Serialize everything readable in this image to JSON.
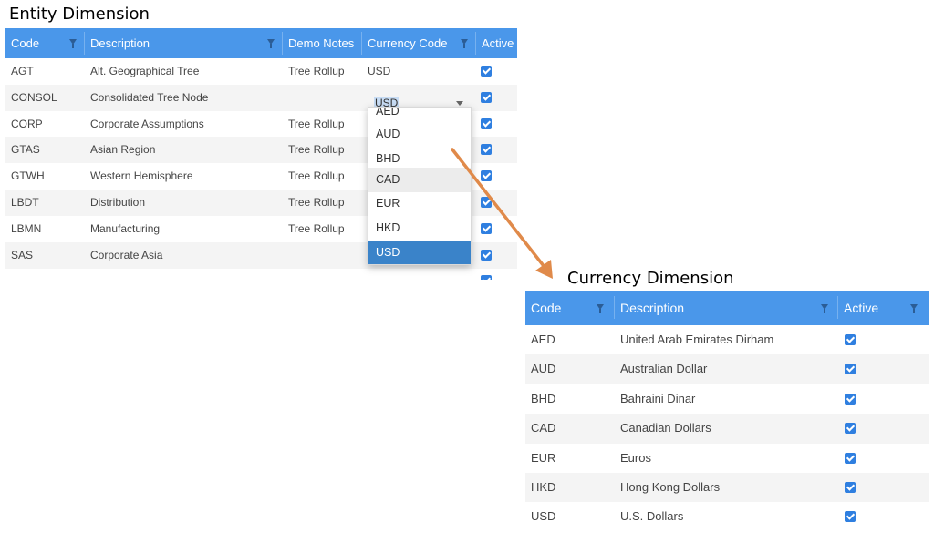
{
  "entity": {
    "title": "Entity Dimension",
    "columns": [
      "Code",
      "Description",
      "Demo Notes",
      "Currency Code",
      "Active"
    ],
    "rows": [
      {
        "code": "AGT",
        "description": "Alt. Geographical Tree",
        "notes": "Tree Rollup",
        "currency": "USD",
        "active": true
      },
      {
        "code": "CONSOL",
        "description": "Consolidated Tree Node",
        "notes": "",
        "currency": "",
        "active": true
      },
      {
        "code": "CORP",
        "description": "Corporate Assumptions",
        "notes": "Tree Rollup",
        "currency": "",
        "active": true
      },
      {
        "code": "GTAS",
        "description": "Asian Region",
        "notes": "Tree Rollup",
        "currency": "",
        "active": true
      },
      {
        "code": "GTWH",
        "description": "Western Hemisphere",
        "notes": "Tree Rollup",
        "currency": "",
        "active": true
      },
      {
        "code": "LBDT",
        "description": "Distribution",
        "notes": "Tree Rollup",
        "currency": "",
        "active": true
      },
      {
        "code": "LBMN",
        "description": "Manufacturing",
        "notes": "Tree Rollup",
        "currency": "",
        "active": true
      },
      {
        "code": "SAS",
        "description": "Corporate Asia",
        "notes": "",
        "currency": "",
        "active": true
      }
    ],
    "editor_value": "USD",
    "dropdown": {
      "options": [
        "AED",
        "AUD",
        "BHD",
        "CAD",
        "EUR",
        "HKD",
        "USD"
      ],
      "hovered": "CAD",
      "selected": "USD"
    }
  },
  "currency": {
    "title": "Currency Dimension",
    "columns": [
      "Code",
      "Description",
      "Active"
    ],
    "rows": [
      {
        "code": "AED",
        "description": "United Arab Emirates Dirham",
        "active": true
      },
      {
        "code": "AUD",
        "description": "Australian Dollar",
        "active": true
      },
      {
        "code": "BHD",
        "description": "Bahraini Dinar",
        "active": true
      },
      {
        "code": "CAD",
        "description": "Canadian Dollars",
        "active": true
      },
      {
        "code": "EUR",
        "description": "Euros",
        "active": true
      },
      {
        "code": "HKD",
        "description": "Hong Kong Dollars",
        "active": true
      },
      {
        "code": "USD",
        "description": "U.S. Dollars",
        "active": true
      }
    ]
  },
  "colors": {
    "header": "#4a97ea",
    "checkbox": "#2f7fe0",
    "selected_option": "#3a83c9",
    "arrow": "#e08a4a"
  }
}
